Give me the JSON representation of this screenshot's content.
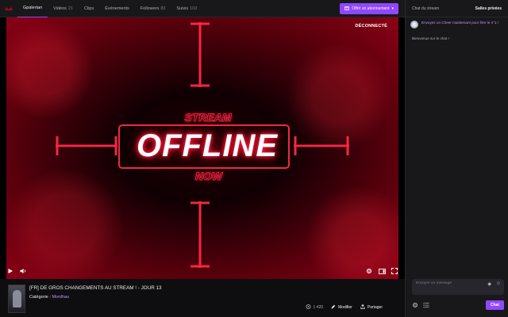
{
  "nav": {
    "channel": "Gpalertan",
    "tabs": [
      {
        "label": "Vidéos",
        "count": "21"
      },
      {
        "label": "Clips",
        "count": ""
      },
      {
        "label": "Événements",
        "count": ""
      },
      {
        "label": "Followers",
        "count": "83"
      },
      {
        "label": "Suivis",
        "count": "103"
      }
    ],
    "subscribe_label": "Offrir un abonnement",
    "accent": "#9147ff"
  },
  "player": {
    "status_label": "DÉCONNECTÉ",
    "art_top": "STREAM",
    "art_main": "OFFLINE",
    "art_bottom": "NOW",
    "glow_color": "#ff1a3a"
  },
  "info": {
    "title": "[FR] DE GROS CHANGEMENTS AU STREAM ! - JOUR 13",
    "category_label": "Catégorie :",
    "category_value": "Mordhau",
    "views": "1 420",
    "edit_label": "Modifier",
    "share_label": "Partager"
  },
  "chat": {
    "title": "Chat du stream",
    "private_label": "Salles privées",
    "cheer_text": "Envoyez un Cheer maintenant pour être le n°1 !",
    "welcome_text": "Bienvenue sur le chat !",
    "input_placeholder": "Envoyer un message",
    "send_label": "Chat"
  }
}
